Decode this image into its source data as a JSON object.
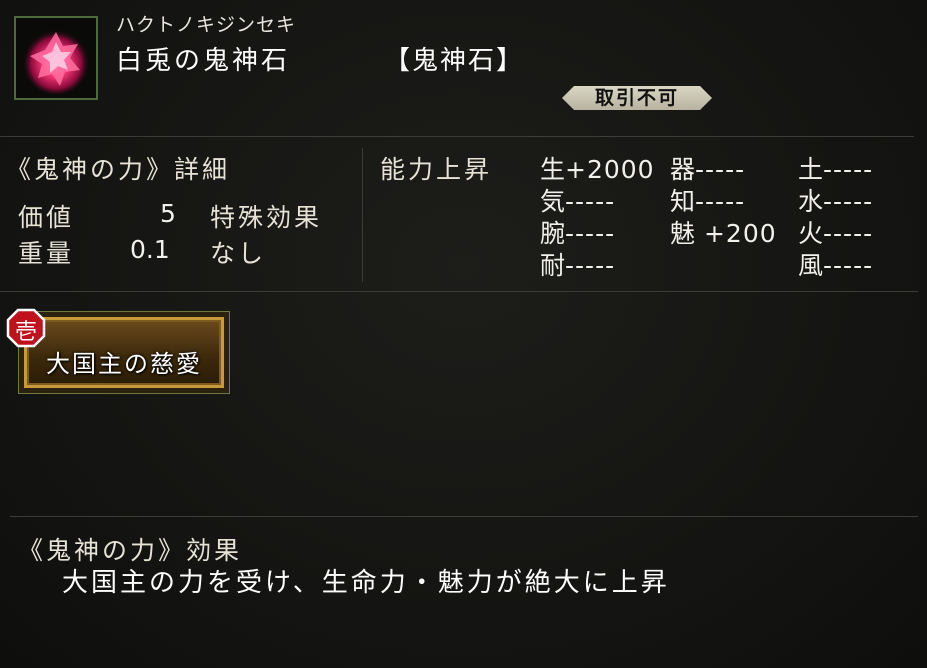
{
  "header": {
    "reading": "ハクトノキジンセキ",
    "name": "白兎の鬼神石",
    "type": "【鬼神石】",
    "trade_status": "取引不可"
  },
  "details": {
    "title": "《鬼神の力》詳細",
    "value_label": "価値",
    "value": "5",
    "weight_label": "重量",
    "weight": "0.1",
    "special_label": "特殊効果",
    "special_value": "なし"
  },
  "stats": {
    "title": "能力上昇",
    "items": [
      {
        "key": "生",
        "value": "+2000"
      },
      {
        "key": "器",
        "value": "-----"
      },
      {
        "key": "土",
        "value": "-----"
      },
      {
        "key": "気",
        "value": "-----"
      },
      {
        "key": "知",
        "value": "-----"
      },
      {
        "key": "水",
        "value": "-----"
      },
      {
        "key": "腕",
        "value": "-----"
      },
      {
        "key": "魅",
        "value": " +200"
      },
      {
        "key": "火",
        "value": "-----"
      },
      {
        "key": "耐",
        "value": "-----"
      },
      {
        "key": "風",
        "value": "-----"
      }
    ]
  },
  "skill": {
    "rank": "壱",
    "label": "大国主の慈愛"
  },
  "effect": {
    "title": "《鬼神の力》効果",
    "description": "大国主の力を受け、生命力・魅力が絶大に上昇"
  },
  "colors": {
    "accent_gold": "#c99a3a",
    "badge_red": "#c0121c",
    "gem_pink": "#ff3a7a"
  }
}
